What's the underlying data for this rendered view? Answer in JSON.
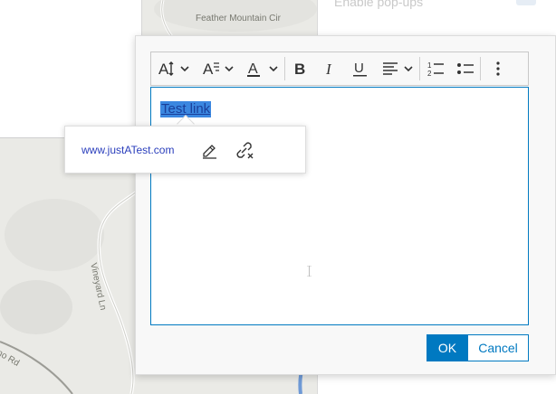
{
  "map": {
    "labels": {
      "feather_mountain": "Feather Mountain Cir",
      "vineyard": "Vineyard Ln",
      "road": "no Rd"
    }
  },
  "side_panel": {
    "faded_text": "Enable pop-ups"
  },
  "toolbar": {
    "items": [
      {
        "name": "font-size-dropdown",
        "icon": "font-size-icon"
      },
      {
        "name": "font-style-dropdown",
        "icon": "text-style-icon"
      },
      {
        "name": "font-color-dropdown",
        "icon": "font-color-icon"
      },
      {
        "name": "bold-button",
        "icon": "bold-icon"
      },
      {
        "name": "italic-button",
        "icon": "italic-icon"
      },
      {
        "name": "underline-button",
        "icon": "underline-icon"
      },
      {
        "name": "align-dropdown",
        "icon": "align-left-icon"
      },
      {
        "name": "numbered-list-button",
        "icon": "numbered-list-icon"
      },
      {
        "name": "bulleted-list-button",
        "icon": "bulleted-list-icon"
      },
      {
        "name": "more-button",
        "icon": "more-vertical-icon"
      }
    ]
  },
  "editor": {
    "content": "Test link"
  },
  "popover": {
    "link_text": "www.justATest.com"
  },
  "buttons": {
    "ok": "OK",
    "cancel": "Cancel"
  },
  "colors": {
    "accent": "#0079c1",
    "selection": "#3b87e0",
    "link": "#2a3ebc"
  }
}
